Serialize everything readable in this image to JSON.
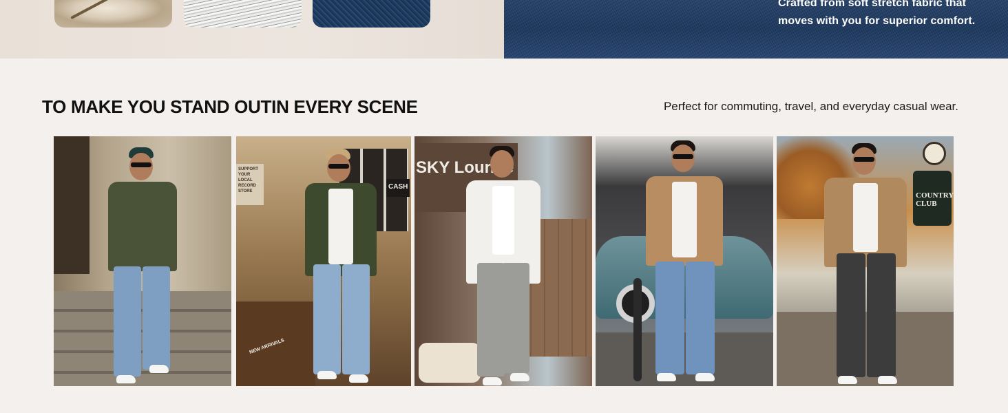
{
  "top_band": {
    "swatches": [
      {
        "icon": "cotton-swatch"
      },
      {
        "icon": "fiber-swatch"
      },
      {
        "icon": "denim-swatch"
      }
    ],
    "denim_text": "Crafted from soft stretch fabric that moves with you for superior comfort."
  },
  "section": {
    "title": "TO MAKE YOU STAND OUTIN EVERY SCENE",
    "subtitle": "Perfect for commuting, travel, and everyday casual wear."
  },
  "gallery": {
    "photos": [
      {
        "scene": "street steps",
        "jacket_color": "#4a5338",
        "jeans_color": "#7f9fc2"
      },
      {
        "scene": "record store",
        "sign": "SUPPORT YOUR LOCAL RECORD STORE",
        "poster": "CASH",
        "crate_label": "NEW ARRIVALS",
        "jacket_color": "#3d4a2e",
        "jeans_color": "#8eaccc"
      },
      {
        "scene": "sky lounge",
        "sign": "SKY Lounge",
        "jacket_color": "#f2f0ec",
        "jeans_color": "#9c9c98"
      },
      {
        "scene": "parked car",
        "jacket_color": "#b98d62",
        "jeans_color": "#6f93bd"
      },
      {
        "scene": "country club",
        "sign": "COUNTRY CLUB",
        "jacket_color": "#b08a5e",
        "jeans_color": "#3c3c3c"
      }
    ]
  }
}
